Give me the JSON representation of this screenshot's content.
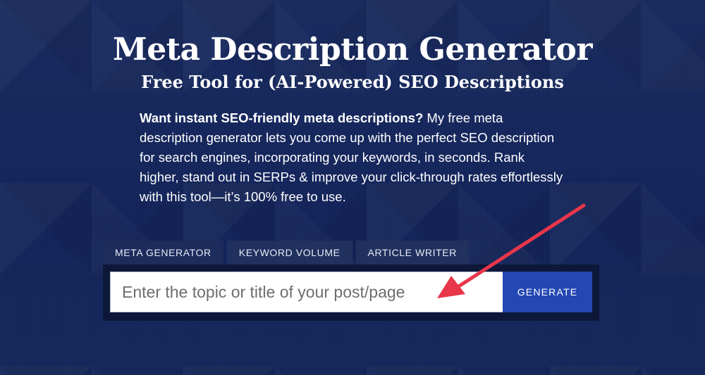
{
  "header": {
    "title": "Meta Description Generator",
    "subtitle": "Free Tool for (AI-Powered) SEO Descriptions"
  },
  "intro": {
    "lead_bold": "Want instant SEO-friendly meta descriptions?",
    "body": " My free meta description generator lets you come up with the perfect SEO description for search engines, incorporating your keywords, in seconds. Rank higher, stand out in SERPs & improve your click-through rates effortlessly with this tool—it’s 100% free to use."
  },
  "tabs": [
    {
      "label": "META GENERATOR",
      "active": true
    },
    {
      "label": "KEYWORD VOLUME",
      "active": false
    },
    {
      "label": "ARTICLE WRITER",
      "active": false
    }
  ],
  "form": {
    "input_value": "",
    "input_placeholder": "Enter the topic or title of your post/page",
    "button_label": "GENERATE"
  },
  "colors": {
    "background": "#15275a",
    "button": "#2447b4",
    "arrow": "#e8364a"
  },
  "icons": {
    "annotation": "arrow-annotation-icon"
  }
}
